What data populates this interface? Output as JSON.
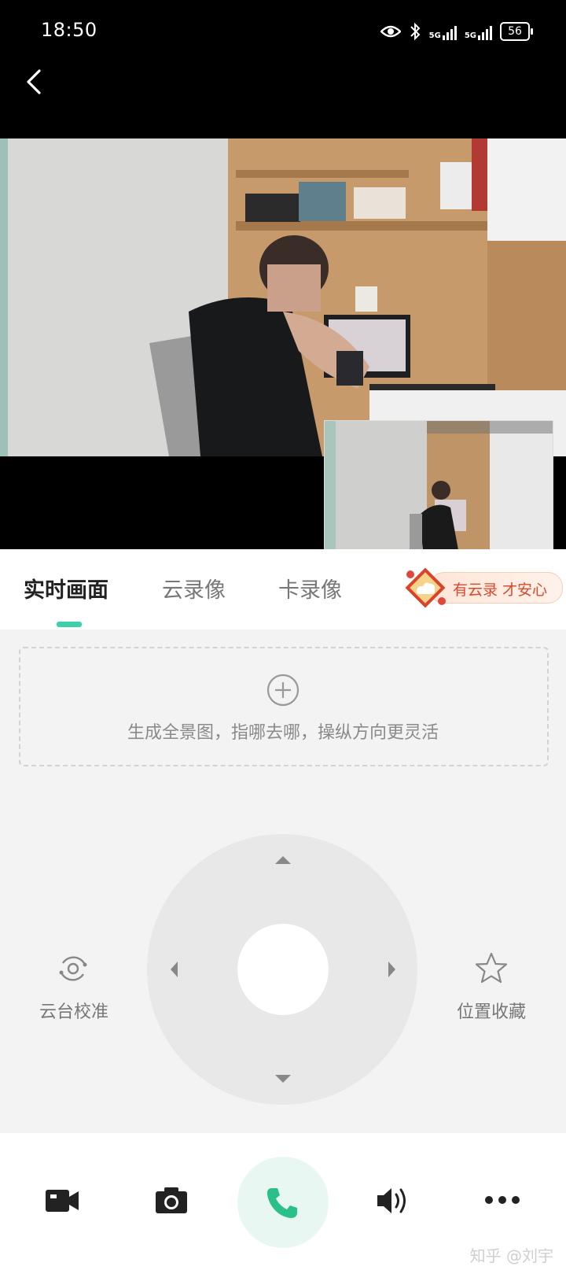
{
  "status_bar": {
    "time": "18:50",
    "network1": "5G",
    "network2": "5G",
    "battery": "56"
  },
  "tabs": [
    {
      "label": "实时画面",
      "active": true
    },
    {
      "label": "云录像",
      "active": false
    },
    {
      "label": "卡录像",
      "active": false
    }
  ],
  "promo": {
    "text": "有云录 才安心"
  },
  "panorama": {
    "hint": "生成全景图，指哪去哪，操纵方向更灵活"
  },
  "ptz": {
    "calibrate_label": "云台校准",
    "favorite_label": "位置收藏"
  },
  "toolbar": {
    "icons": [
      "video-record-icon",
      "camera-snapshot-icon",
      "phone-call-icon",
      "speaker-icon",
      "more-icon"
    ]
  },
  "watermark": "知乎 @刘宇",
  "colors": {
    "accent": "#3ccfa8",
    "call_icon": "#2bbf8a",
    "promo_text": "#d84a2f"
  }
}
